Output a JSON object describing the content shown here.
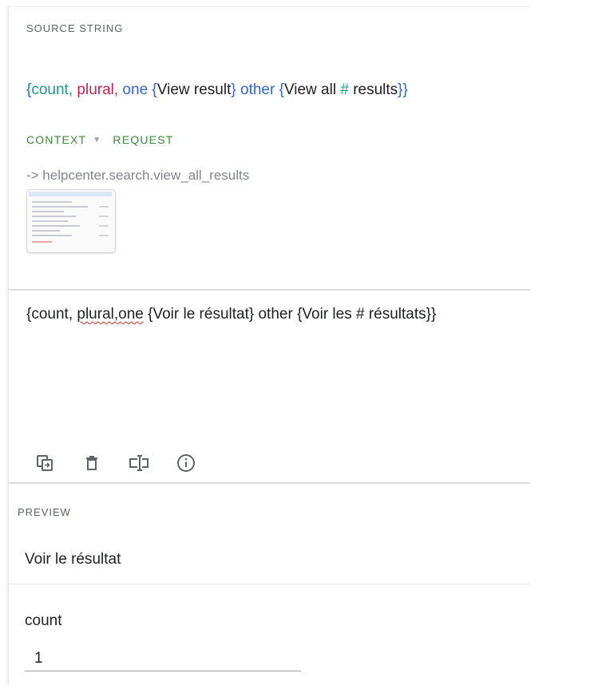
{
  "source": {
    "label": "SOURCE STRING",
    "tokens": {
      "open_brace": "{",
      "count": "count",
      "comma1": ",",
      "plural": " plural,",
      "one": " one",
      "one_open": " {",
      "one_text": "View result",
      "one_close": "}",
      "other": " other",
      "other_open": " {",
      "other_text_a": "View all ",
      "hash": "#",
      "other_text_b": " results",
      "other_close": "}",
      "close_brace": "}"
    }
  },
  "context": {
    "context_label": "CONTEXT",
    "request_label": "REQUEST",
    "key": "-> helpcenter.search.view_all_results"
  },
  "translation": {
    "prefix": "{count, ",
    "misspelled": "plural,one",
    "suffix": " {Voir le résultat} other {Voir les # résultats}}"
  },
  "toolbar": {
    "icons": [
      "copy-source-icon",
      "delete-icon",
      "text-cursor-icon",
      "info-icon"
    ]
  },
  "preview": {
    "label": "PREVIEW",
    "text": "Voir le résultat"
  },
  "variables": {
    "count_label": "count",
    "count_value": "1"
  },
  "colors": {
    "count": "#1e9a8a",
    "plural": "#d01f4f",
    "keyword": "#3367d6",
    "context_green": "#3a8a3a",
    "spell_error": "#d93025"
  }
}
